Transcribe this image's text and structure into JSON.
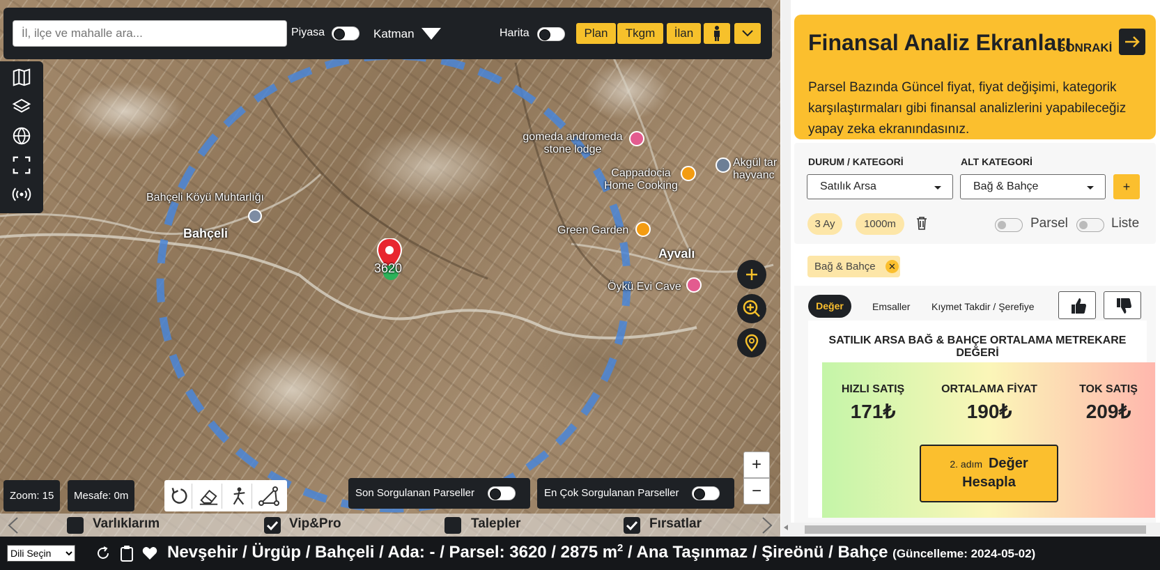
{
  "map": {
    "search_placeholder": "İl, ilçe ve mahalle ara...",
    "piyasa_label": "Piyasa",
    "katman_label": "Katman",
    "harita_label": "Harita",
    "buttons": [
      "Plan",
      "Tkgm",
      "İlan"
    ],
    "places": {
      "gomeda": "gomeda andromeda stone lodge",
      "cappadocia": "Cappadocia Home Cooking",
      "akgul": "Akgül tar hayvanc",
      "bahceli_muhtar": "Bahçeli Köyü Muhtarlığı",
      "bahceli": "Bahçeli",
      "green": "Green Garden",
      "ayvali": "Ayvalı",
      "oyku": "Öykü Evi Cave"
    },
    "parcel_label": "3620",
    "zoom_text": "Zoom: 15",
    "distance_text": "Mesafe: 0m",
    "last_queried": "Son Sorgulanan Parseller",
    "most_queried": "En Çok Sorgulanan Parseller",
    "zoom_in": "+",
    "zoom_out": "−",
    "favs": [
      {
        "label": "Varlıklarım",
        "checked": false
      },
      {
        "label": "Vip&Pro",
        "checked": true
      },
      {
        "label": "Talepler",
        "checked": false
      },
      {
        "label": "Fırsatlar",
        "checked": true
      }
    ]
  },
  "status": {
    "language": "Dili Seçin",
    "path": "Nevşehir / Ürgüp / Bahçeli / Ada: - / Parsel: 3620 / 2875 m",
    "sup": "2",
    "path_rest": " / Ana Taşınmaz / Şireönü / Bahçe",
    "updated": "(Güncelleme: 2024-05-02)"
  },
  "panel": {
    "hero_title": "Finansal Analiz Ekranları",
    "next_label": "SONRAKİ",
    "hero_text": "Parsel Bazında Güncel fiyat, fiyat değişimi, kategorik karşılaştırmaları gibi finansal analizlerini yapabileceğiz yapay zeka ekranındasınız.",
    "durum_label": "DURUM / KATEGORİ",
    "alt_label": "ALT KATEGORİ",
    "durum_value": "Satılık Arsa",
    "alt_value": "Bağ & Bahçe",
    "add": "+",
    "period": "3 Ay",
    "radius": "1000m",
    "parsel_label": "Parsel",
    "liste_label": "Liste",
    "filter_tag": "Bağ & Bahçe",
    "tabs": [
      "Değer",
      "Emsaller",
      "Kıymet Takdir / Şerefiye"
    ],
    "card_title": "SATILIK ARSA BAĞ & BAHÇE ORTALAMA METREKARE DEĞERİ",
    "metrics": [
      {
        "label": "HIZLI SATIŞ",
        "value": "171₺"
      },
      {
        "label": "ORTALAMA FİYAT",
        "value": "190₺"
      },
      {
        "label": "TOK SATIŞ",
        "value": "209₺"
      }
    ],
    "calc_step": "2. adım",
    "calc_line1": "Değer",
    "calc_line2": "Hesapla"
  },
  "colors": {
    "accent": "#fbbf2e",
    "dark": "#1e2125"
  }
}
